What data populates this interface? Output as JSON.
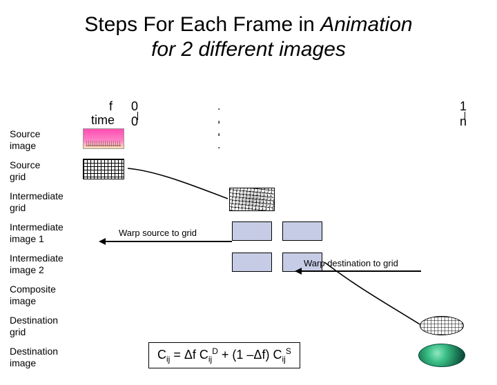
{
  "title_part1": "Steps For Each Frame in ",
  "title_italic": "Animation",
  "title_part2": " for 2 different images",
  "axis": {
    "f": "f",
    "time": "time",
    "zero_top": "0",
    "zero_bot": "0",
    "dots1": ". . .",
    "dots2": ". . .",
    "one": "1",
    "n": "n"
  },
  "rows": {
    "source_image": "Source\nimage",
    "source_grid": "Source\ngrid",
    "intermediate_grid": "Intermediate\ngrid",
    "intermediate_image_1": "Intermediate\nimage 1",
    "intermediate_image_2": "Intermediate\nimage 2",
    "composite_image": "Composite\nimage",
    "destination_grid": "Destination\ngrid",
    "destination_image": "Destination\nimage"
  },
  "labels": {
    "warp_source": "Warp source to grid",
    "warp_dest": "Warp destination to grid"
  },
  "formula": {
    "prefix": "C",
    "ij": "ij",
    "eq": " = Δf C",
    "D": "D",
    "mid": " + (1 –Δf) C",
    "S": "S"
  }
}
